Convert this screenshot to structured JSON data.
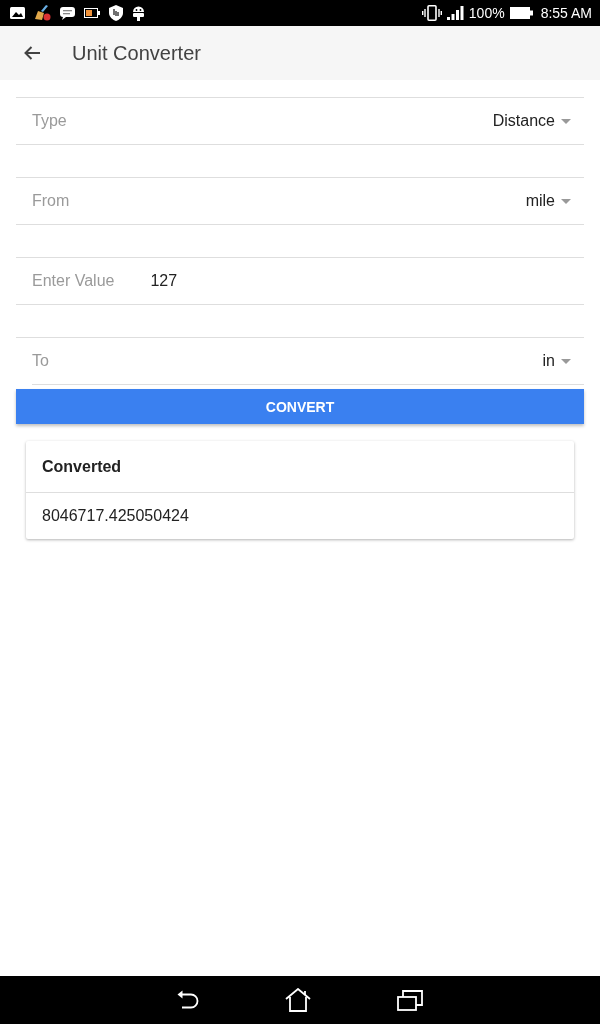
{
  "status_bar": {
    "battery_text": "100%",
    "time": "8:55 AM"
  },
  "app_bar": {
    "title": "Unit Converter"
  },
  "fields": [
    {
      "kind": "select",
      "label": "Type",
      "value": "Distance"
    },
    {
      "kind": "select",
      "label": "From",
      "value": "mile"
    },
    {
      "kind": "input",
      "label": "Enter Value",
      "value": "127"
    },
    {
      "kind": "select",
      "label": "To",
      "value": "in"
    }
  ],
  "convert_button": {
    "label": "CONVERT"
  },
  "result_card": {
    "header": "Converted",
    "value": "8046717.425050424"
  }
}
